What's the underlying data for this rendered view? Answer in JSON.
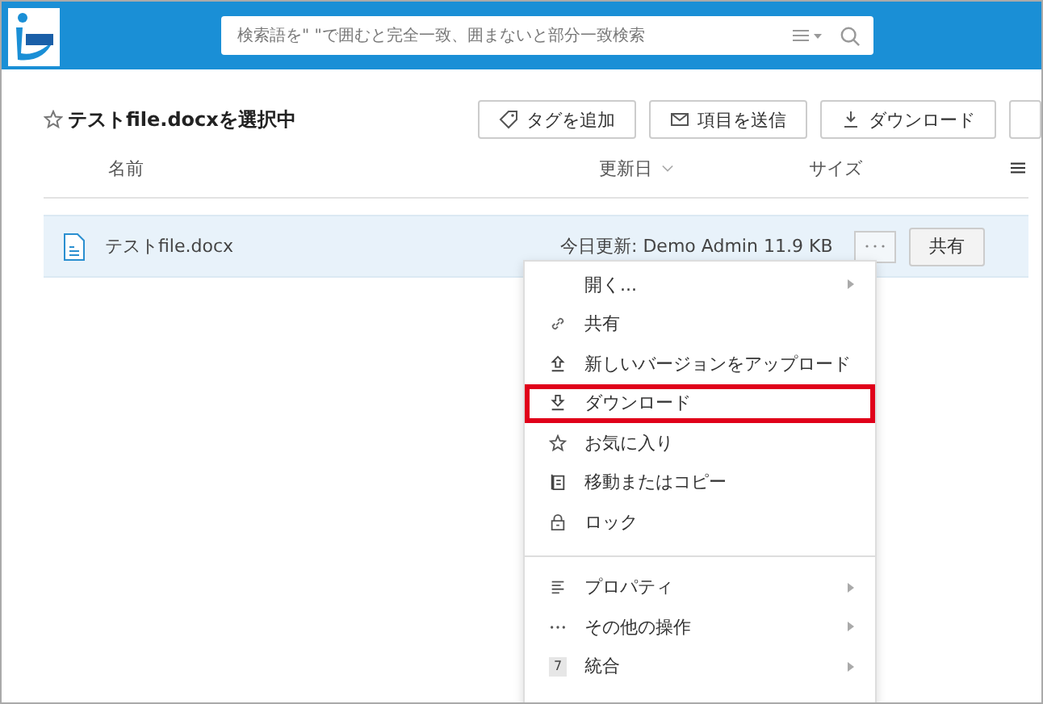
{
  "header": {
    "search": {
      "placeholder": "検索語を\" \"で囲むと完全一致、囲まないと部分一致検索"
    }
  },
  "selection": {
    "starred": false,
    "title": "テストfile.docxを選択中"
  },
  "actions": [
    {
      "kind": "tag",
      "label": "タグを追加"
    },
    {
      "kind": "mail",
      "label": "項目を送信"
    },
    {
      "kind": "download",
      "label": "ダウンロード"
    },
    {
      "kind": "cut"
    }
  ],
  "table": {
    "columns": [
      {
        "label": "名前"
      },
      {
        "label": "更新日"
      },
      {
        "label": "サイズ"
      }
    ],
    "rows": [
      {
        "name": "テストfile.docx",
        "modified": "今日更新: Demo Admin",
        "size": "11.9 KB",
        "share": "共有",
        "selected": true
      }
    ]
  },
  "menu": {
    "items": [
      {
        "kind": "open",
        "label": "開く...",
        "submenu": true,
        "highlighted": false
      },
      {
        "kind": "link",
        "label": "共有",
        "submenu": false,
        "highlighted": false
      },
      {
        "kind": "upload",
        "label": "新しいバージョンをアップロード",
        "submenu": false,
        "highlighted": false
      },
      {
        "kind": "download",
        "label": "ダウンロード",
        "submenu": false,
        "highlighted": true
      },
      {
        "kind": "star",
        "label": "お気に入り",
        "submenu": false,
        "highlighted": false
      },
      {
        "kind": "copy",
        "label": "移動またはコピー",
        "submenu": false,
        "highlighted": false
      },
      {
        "kind": "lock",
        "label": "ロック",
        "submenu": false,
        "highlighted": false
      },
      {
        "kind": "divider"
      },
      {
        "kind": "lines",
        "label": "プロパティ",
        "submenu": true,
        "highlighted": false
      },
      {
        "kind": "dots",
        "label": "その他の操作",
        "submenu": true,
        "highlighted": false
      },
      {
        "kind": "badge",
        "badge": "7",
        "label": "統合",
        "submenu": true,
        "highlighted": false
      }
    ]
  }
}
